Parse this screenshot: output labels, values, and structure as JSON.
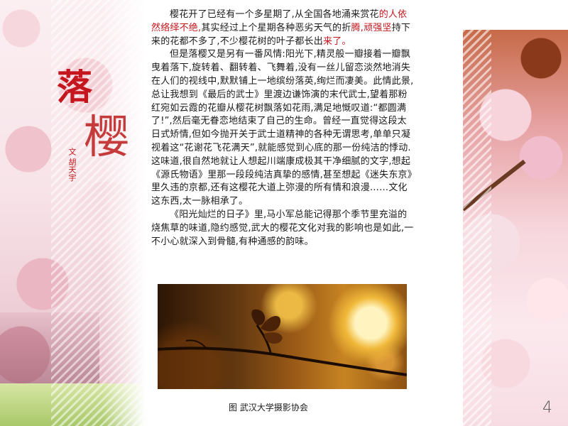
{
  "title": {
    "char1": "落",
    "char2": "樱"
  },
  "author": "文 胡天宇",
  "article": {
    "p1_seg1": "樱花开了已经有一个多星期了,从全国各地涌来赏花",
    "p1_hl1": "的人依然络绎不绝,",
    "p1_seg2": "其实经过上个星期各种恶劣天气的折",
    "p1_hl2": "腾,顽强坚",
    "p1_seg3": "持下来的花都不多了,不少樱花树的叶子都长出",
    "p1_hl3": "来了。",
    "p2": "但是落樱又是另有一番风情:阳光下,精灵般一瓣接着一瓣飘曳着落下,旋转着、翻转着、飞舞着,没有一丝儿留恋淡然地消失在人们的视线中,默默铺上一地缤纷落英,绚烂而凄美。此情此景,总让我想到《最后的武士》里渡边谦饰演的末代武士,望着那粉红宛如云霞的花瓣从樱花树飘落如花雨,满足地慨叹道:“都圆满了!”,然后毫无眷恋地结束了自己的生命。曾经一直觉得这段太日式矫情,但如今抛开关于武士道精神的各种无谓思考,单单只凝视着这“花谢花飞花满天”,就能感觉到心底的那一份纯洁的悸动.这味道,很自然地就让人想起川端康成极其干净细腻的文字,想起《源氏物语》里那一段段纯洁真挚的感情,甚至想起《迷失东京》里久违的京都,还有这樱花大道上弥漫的所有情和浪漫……文化这东西,太一脉相承了。",
    "p3": "《阳光灿烂的日子》里,马小军总能记得那个季节里充溢的烧焦草的味道,隐约感觉,武大的樱花文化对我的影响也是如此,一不小心就深入到骨髓,有种通感的韵味。"
  },
  "caption": "图 武汉大学摄影协会",
  "page_number": "4",
  "colors": {
    "accent_red": "#c4161c",
    "body_text": "#1a1a1a"
  }
}
